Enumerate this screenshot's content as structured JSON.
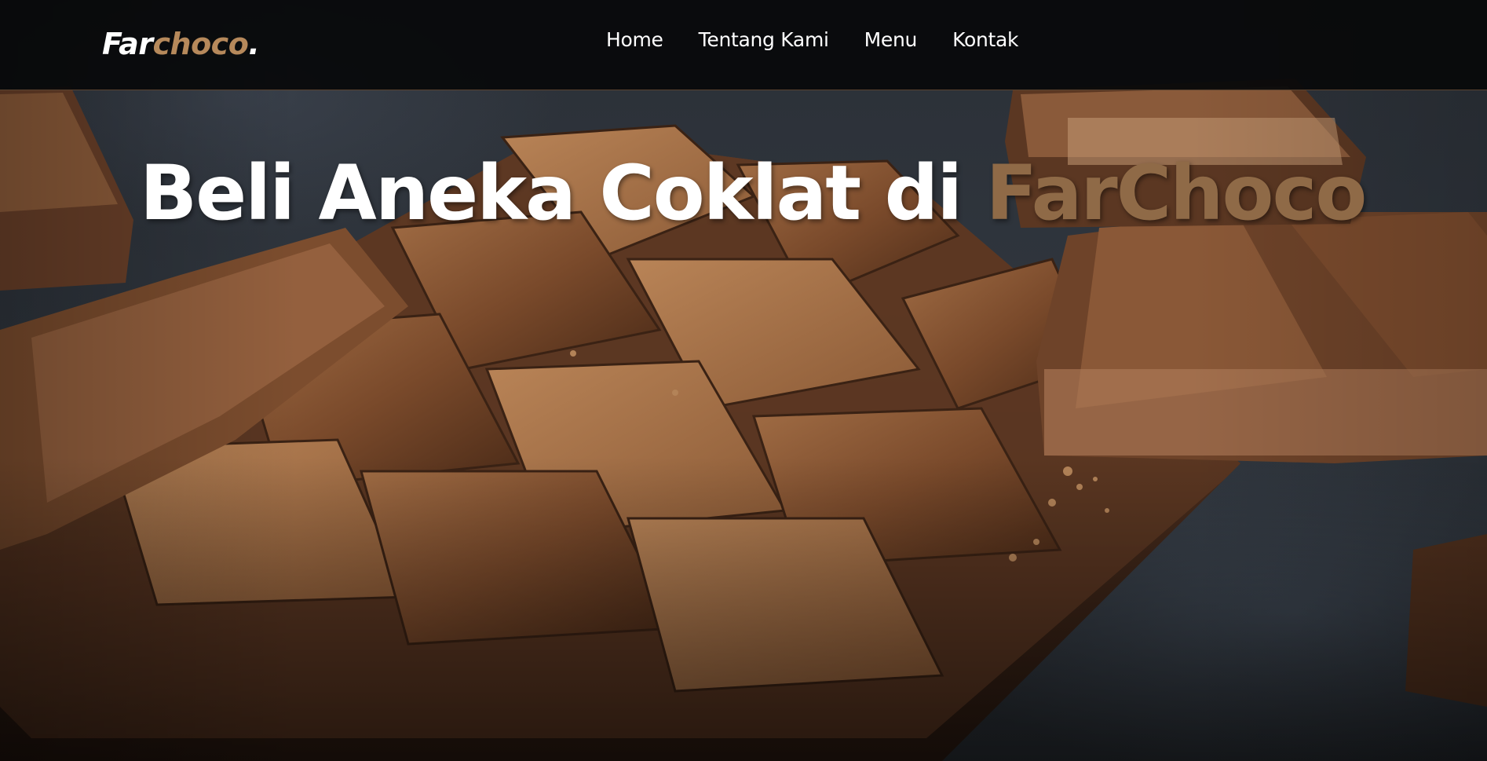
{
  "navbar": {
    "logo": {
      "main": "Far",
      "accent": "choco",
      "dot": "."
    },
    "links": [
      "Home",
      "Tentang Kami",
      "Menu",
      "Kontak"
    ]
  },
  "hero": {
    "headline_prefix": "Beli Aneka Coklat di ",
    "headline_brand": "FarChoco",
    "background_image": "chocolate-bar-photo"
  },
  "colors": {
    "navbar_bg": "#08090a",
    "accent": "#b6895b",
    "headline_brand": "#8f6a47",
    "text": "#ffffff"
  }
}
